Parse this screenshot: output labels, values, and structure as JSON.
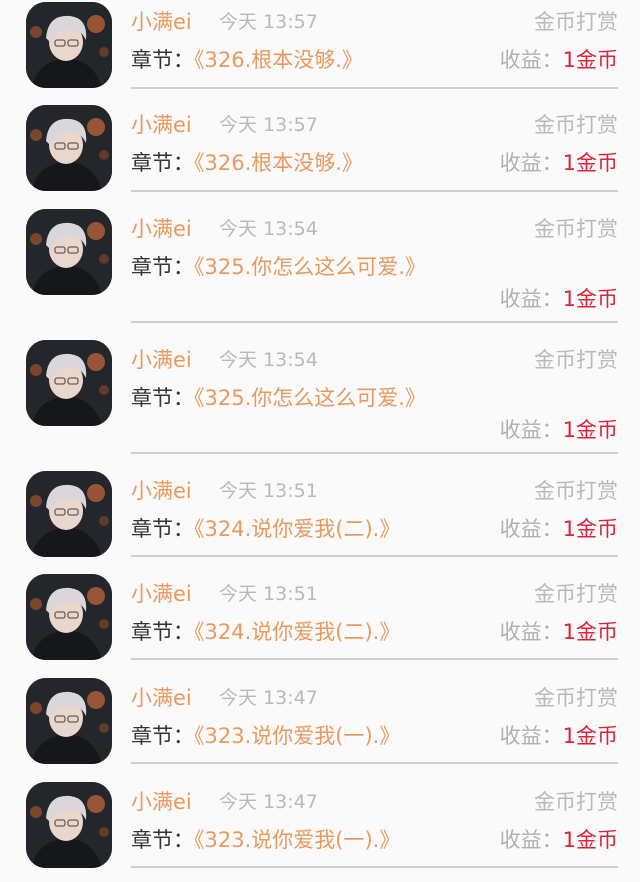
{
  "colors": {
    "username": "#e69a60",
    "chapter_title": "#e69a60",
    "muted": "#b9b9b9",
    "income_value": "#d9243a",
    "divider": "#cfcfcf"
  },
  "items": [
    {
      "username": "小满ei",
      "time": "今天 13:57",
      "reward": "金币打赏",
      "chapter_label": "章节：",
      "chapter_title": "《326.根本没够.》",
      "income_label": "收益：",
      "income_value": "1金币"
    },
    {
      "username": "小满ei",
      "time": "今天 13:57",
      "reward": "金币打赏",
      "chapter_label": "章节：",
      "chapter_title": "《326.根本没够.》",
      "income_label": "收益：",
      "income_value": "1金币"
    },
    {
      "username": "小满ei",
      "time": "今天 13:54",
      "reward": "金币打赏",
      "chapter_label": "章节：",
      "chapter_title": "《325.你怎么这么可爱.》",
      "income_label": "收益：",
      "income_value": "1金币"
    },
    {
      "username": "小满ei",
      "time": "今天 13:54",
      "reward": "金币打赏",
      "chapter_label": "章节：",
      "chapter_title": "《325.你怎么这么可爱.》",
      "income_label": "收益：",
      "income_value": "1金币"
    },
    {
      "username": "小满ei",
      "time": "今天 13:51",
      "reward": "金币打赏",
      "chapter_label": "章节：",
      "chapter_title": "《324.说你爱我(二).》",
      "income_label": "收益：",
      "income_value": "1金币"
    },
    {
      "username": "小满ei",
      "time": "今天 13:51",
      "reward": "金币打赏",
      "chapter_label": "章节：",
      "chapter_title": "《324.说你爱我(二).》",
      "income_label": "收益：",
      "income_value": "1金币"
    },
    {
      "username": "小满ei",
      "time": "今天 13:47",
      "reward": "金币打赏",
      "chapter_label": "章节：",
      "chapter_title": "《323.说你爱我(一).》",
      "income_label": "收益：",
      "income_value": "1金币"
    },
    {
      "username": "小满ei",
      "time": "今天 13:47",
      "reward": "金币打赏",
      "chapter_label": "章节：",
      "chapter_title": "《323.说你爱我(一).》",
      "income_label": "收益：",
      "income_value": "1金币"
    }
  ]
}
